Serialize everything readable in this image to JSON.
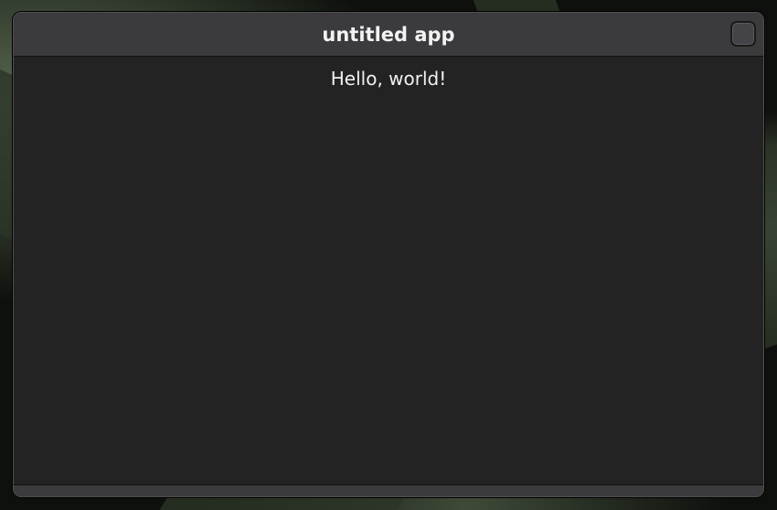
{
  "window": {
    "title": "untitled app"
  },
  "content": {
    "label": "Hello, world!"
  },
  "colors": {
    "titlebar": "#3b3a3d",
    "content_bg": "#232323",
    "text": "#f0f0f0"
  },
  "icons": {
    "close": "window-close-button"
  }
}
